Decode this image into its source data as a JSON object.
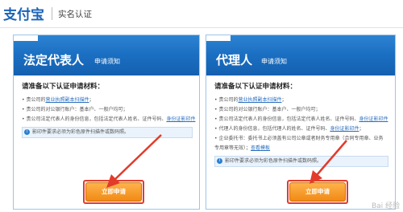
{
  "header": {
    "logo_text": "支付宝",
    "page_title": "实名认证"
  },
  "cards": {
    "legal_rep": {
      "title": "法定代表人",
      "subtitle": "申请须知",
      "requirements_title": "请准备以下认证申请材料：",
      "items": [
        {
          "prefix": "• 贵公司的",
          "link": "营业执照副本扫描件",
          "suffix": "；"
        },
        {
          "prefix": "• 贵公司的对公银行账户：基本户、一般户均可；",
          "link": "",
          "suffix": ""
        },
        {
          "prefix": "• 贵公司法定代表人的身份信息，包括法定代表人姓名、证件号码、",
          "link": "身份证影印件",
          "suffix": ""
        }
      ],
      "note": "影印件要求必须为彩色原件扫描件或数码照。",
      "button_label": "立即申请"
    },
    "agent": {
      "title": "代理人",
      "subtitle": "申请须知",
      "requirements_title": "请准备以下认证申请材料：",
      "items": [
        {
          "prefix": "• 贵公司的",
          "link": "营业执照副本扫描件",
          "suffix": "；"
        },
        {
          "prefix": "• 贵公司的对公银行账户：基本户、一般户均可；",
          "link": "",
          "suffix": ""
        },
        {
          "prefix": "• 贵公司法定代表人的身份信息，包括法定代表人姓名、证件号码、",
          "link": "身份证影印件",
          "suffix": ""
        },
        {
          "prefix": "• 代理人的身份信息，包括代理人的姓名、证件号码、",
          "link": "身份证影印件",
          "suffix": "；"
        },
        {
          "prefix": "• 企业委托书：委托书上必须盖有公司公章或者财务专用章（合同专用章、业务",
          "link": "",
          "suffix": ""
        },
        {
          "prefix": "  专用章等无效）；",
          "link": "查看模板",
          "suffix": ""
        }
      ],
      "note": "影印件要求必须为彩色原件扫描件或数码照。",
      "button_label": "立即申请"
    }
  },
  "annotation_color": "#e23b2c",
  "watermark": "Bai 经验"
}
